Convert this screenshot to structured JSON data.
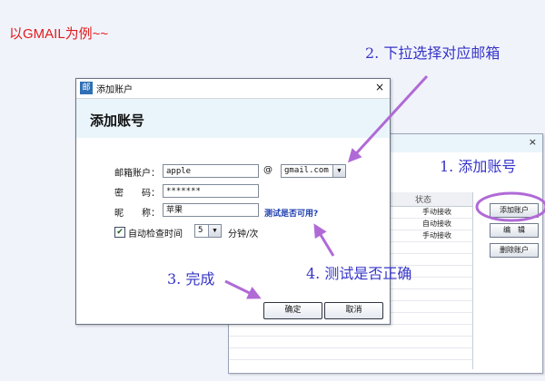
{
  "page": {
    "caption": "以GMAIL为例~~"
  },
  "annotations": {
    "step1": "1. 添加账号",
    "step2": "2. 下拉选择对应邮箱",
    "step3": "3. 完成",
    "step4": "4. 测试是否正确"
  },
  "background_window": {
    "close_glyph": "×",
    "status_header": "状态",
    "rows": [
      "手动接收",
      "自动接收",
      "手动接收"
    ],
    "buttons": {
      "add": "添加账户",
      "edit": "编　辑",
      "delete": "删除账户"
    }
  },
  "dialog": {
    "window_title": "添加账户",
    "app_icon_glyph": "邮",
    "close_glyph": "×",
    "heading": "添加账号",
    "fields": {
      "account_label": "邮箱账户：",
      "account_value": "apple",
      "at_symbol": "@",
      "domain_value": "gmail.com",
      "password_label": "密　　码：",
      "password_value": "*******",
      "nickname_label": "昵　　称：",
      "nickname_value": "苹果"
    },
    "test_link": "测试是否可用?",
    "auto_check": {
      "checked": true,
      "label": "自动检查时间",
      "interval_value": "5",
      "unit": "分钟/次"
    },
    "buttons": {
      "ok": "确定",
      "cancel": "取消"
    }
  },
  "colors": {
    "annotation": "#3534c8",
    "highlight": "#b06ad6",
    "caption": "#e21b1b",
    "link": "#1f3fae"
  }
}
